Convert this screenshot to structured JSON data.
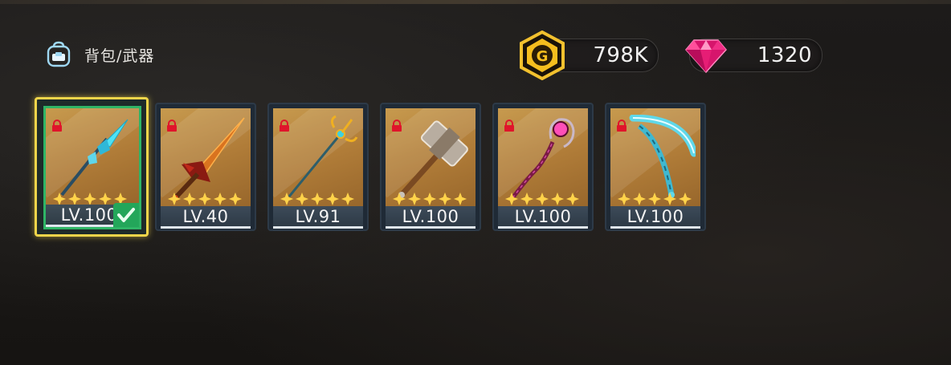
{
  "header": {
    "title": "背包/武器",
    "icon": "backpack-icon"
  },
  "currency": {
    "gold": {
      "icon": "gold-coin-icon",
      "value": "798K",
      "color": "#f0b400"
    },
    "gems": {
      "icon": "pink-gem-icon",
      "value": "1320",
      "color": "#e8217a"
    }
  },
  "weapons": [
    {
      "name": "spear",
      "level_label": "LV.100",
      "stars": 5,
      "locked": true,
      "selected": true
    },
    {
      "name": "sword",
      "level_label": "LV.40",
      "stars": 5,
      "locked": true,
      "selected": false
    },
    {
      "name": "trident",
      "level_label": "LV.91",
      "stars": 5,
      "locked": true,
      "selected": false
    },
    {
      "name": "hammer",
      "level_label": "LV.100",
      "stars": 5,
      "locked": true,
      "selected": false
    },
    {
      "name": "staff",
      "level_label": "LV.100",
      "stars": 5,
      "locked": true,
      "selected": false
    },
    {
      "name": "scythe",
      "level_label": "LV.100",
      "stars": 5,
      "locked": true,
      "selected": false
    }
  ],
  "colors": {
    "selected_border": "#f0d54a",
    "selected_inner": "#2fb566",
    "lock": "#e0152b",
    "star": "#ffd34a"
  }
}
